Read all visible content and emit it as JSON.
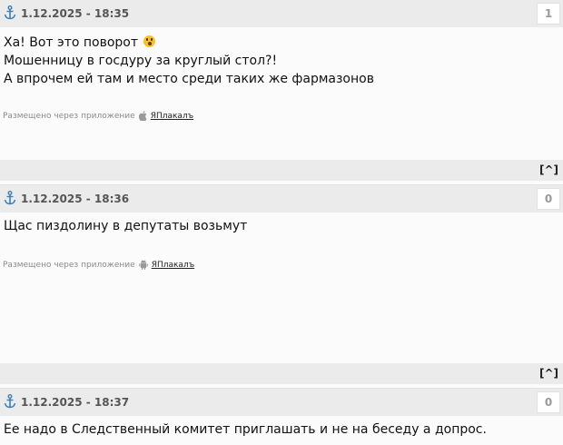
{
  "posts": [
    {
      "date": "1.12.2025 - 18:35",
      "rating": "1",
      "lines": [
        "Ха! Вот это поворот",
        "Мошенницу в госдуру за круглый стол?!",
        "А впрочем ей там и место среди таких же фармазонов"
      ],
      "emoji": "astonished-face",
      "via_text": "Размещено через приложение",
      "via_os": "apple-icon",
      "app_name": "ЯПлакалъ"
    },
    {
      "date": "1.12.2025 - 18:36",
      "rating": "0",
      "lines": [
        "Щас пиздолину в депутаты возьмут"
      ],
      "via_text": "Размещено через приложение",
      "via_os": "android-icon",
      "app_name": "ЯПлакалъ"
    },
    {
      "date": "1.12.2025 - 18:37",
      "rating": "0",
      "lines": [
        "Ее надо в Следственный комитет приглашать и не на беседу а допрос."
      ]
    }
  ],
  "footer": {
    "up_label": "[^]"
  },
  "colors": {
    "header_bg": "#ebebeb",
    "body_bg": "#fbfbfb",
    "anchor": "#3d7fb5"
  }
}
